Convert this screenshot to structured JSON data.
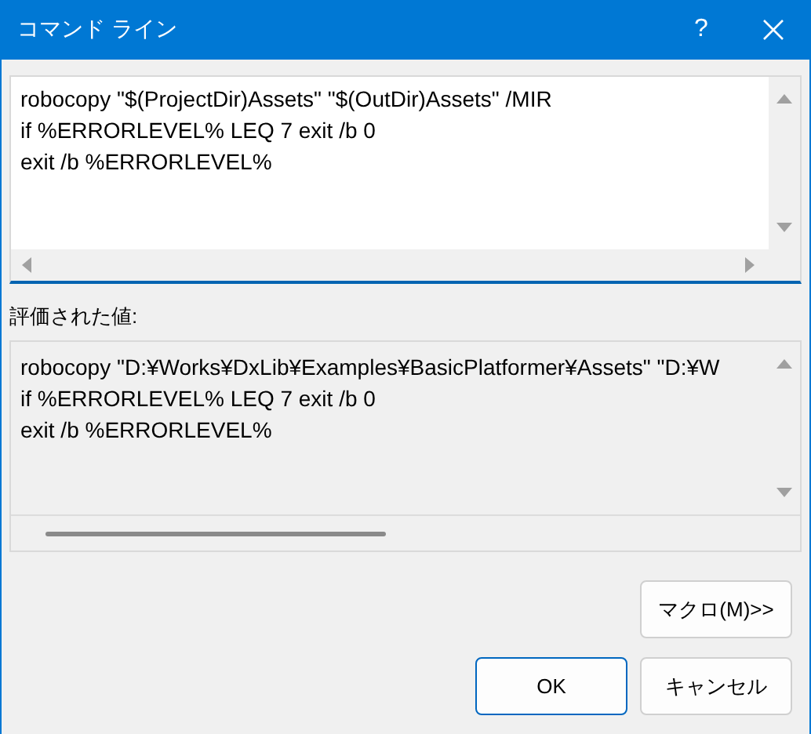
{
  "window": {
    "title": "コマンド ライン",
    "help_button": "?"
  },
  "command_editor": {
    "focused": true,
    "lines": [
      "robocopy \"$(ProjectDir)Assets\" \"$(OutDir)Assets\" /MIR",
      "if %ERRORLEVEL% LEQ 7 exit /b 0",
      "exit /b %ERRORLEVEL%"
    ]
  },
  "evaluated": {
    "label": "評価された値:",
    "lines": [
      "robocopy \"D:¥Works¥DxLib¥Examples¥BasicPlatformer¥Assets\" \"D:¥W",
      "if %ERRORLEVEL% LEQ 7 exit /b 0",
      "exit /b %ERRORLEVEL%"
    ]
  },
  "buttons": [
    {
      "kind": "macro",
      "label": "マクロ(M)>>",
      "default": false
    },
    {
      "kind": "ok",
      "label": "OK",
      "default": true
    },
    {
      "kind": "cancel",
      "label": "キャンセル",
      "default": false
    }
  ]
}
